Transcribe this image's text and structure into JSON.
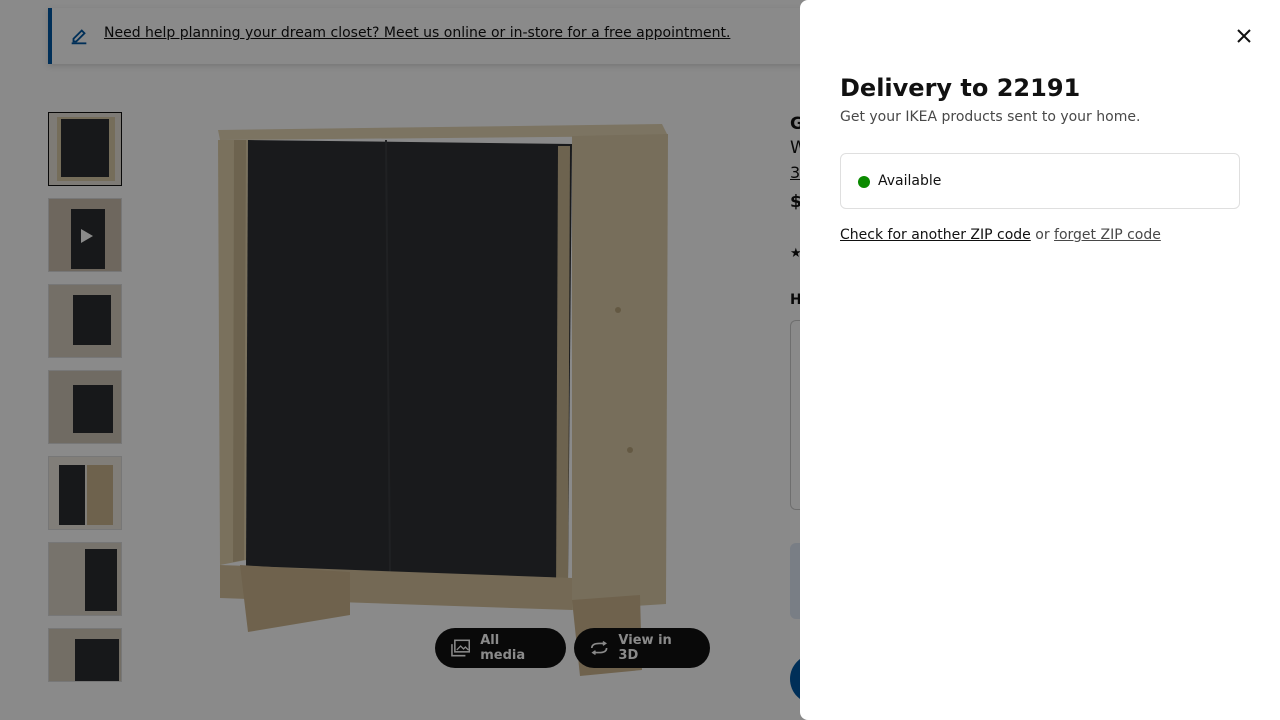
{
  "banner": {
    "text": "Need help planning your dream closet? Meet us online or in-store for a free appointment.",
    "icon": "pencil-icon"
  },
  "gallery": {
    "all_media_label": "All media",
    "view_3d_label": "View in 3D",
    "thumbnail_count": 7
  },
  "product_info_partial": {
    "line1": "G",
    "line2": "W",
    "line3": "3",
    "line4": "$",
    "line5": "H"
  },
  "modal": {
    "title": "Delivery to 22191",
    "subtitle": "Get your IKEA products sent to your home.",
    "status": "Available",
    "status_color": "#0a8a00",
    "check_link": "Check for another ZIP code",
    "or_text": "or",
    "forget_link": "forget ZIP code",
    "close_icon": "close-icon"
  },
  "colors": {
    "brand_blue": "#0058a3",
    "overlay": "rgba(0,0,0,0.46)"
  }
}
